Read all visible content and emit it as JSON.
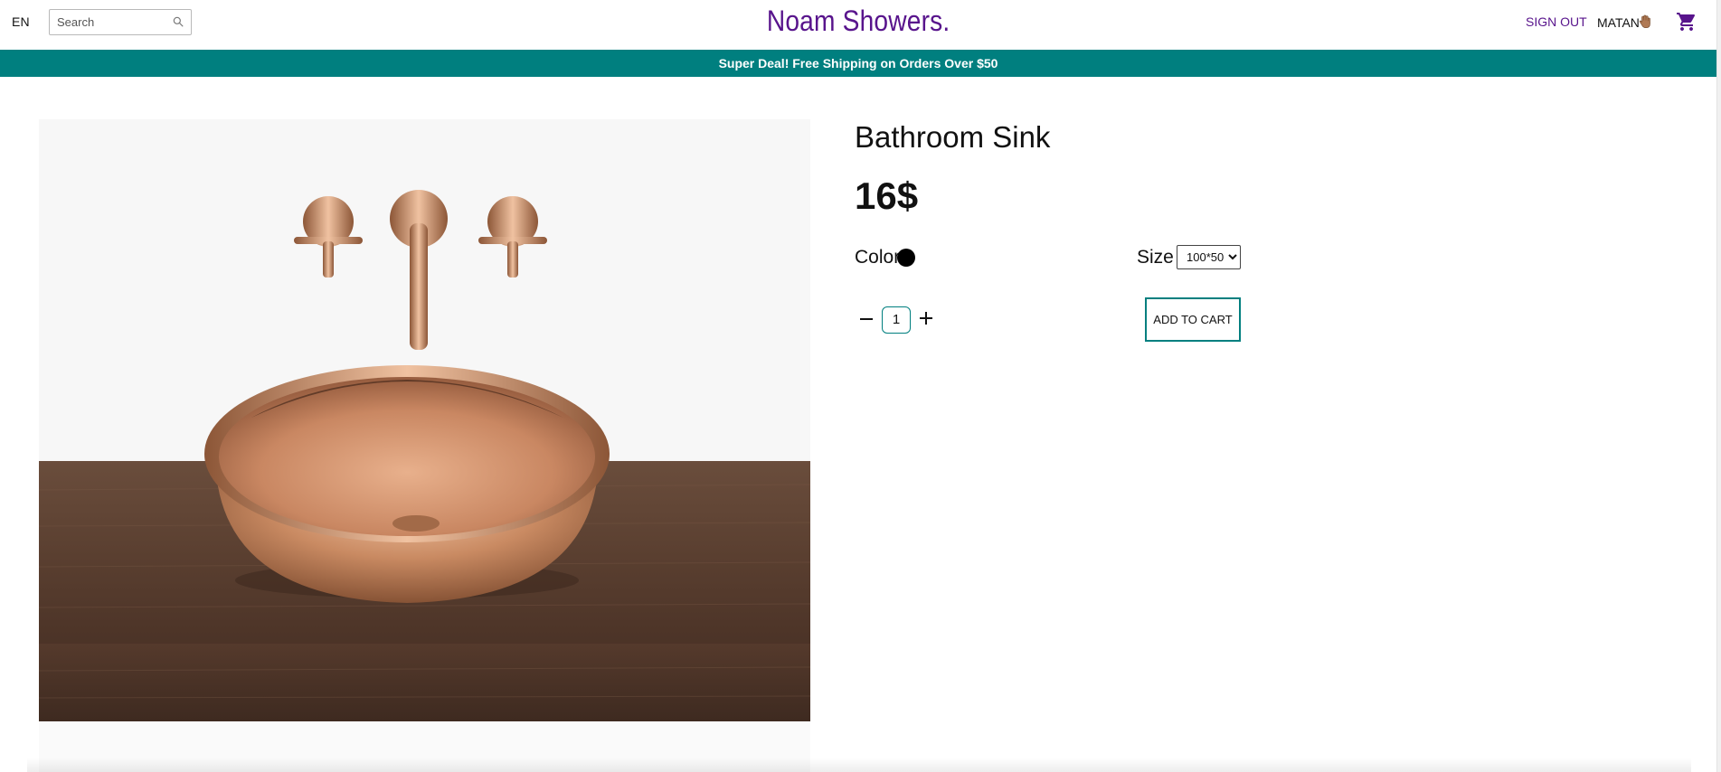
{
  "header": {
    "language": "EN",
    "search_placeholder": "Search",
    "brand": "Noam Showers.",
    "sign_out": "SIGN OUT",
    "user_name": "MATAN",
    "user_icon": "waving-hand-icon",
    "cart_icon": "shopping-cart-icon"
  },
  "promo": {
    "text": "Super Deal! Free Shipping on Orders Over $50"
  },
  "product": {
    "image_alt": "copper vessel sink on wooden countertop with wall faucet",
    "title": "Bathroom Sink",
    "price": "16$",
    "color_label": "Color",
    "selected_color": "#000000",
    "size_label": "Size",
    "size_selected": "100*50",
    "quantity": "1",
    "add_to_cart": "ADD TO CART"
  },
  "colors": {
    "brand": "#58148c",
    "accent": "#007f7f"
  }
}
